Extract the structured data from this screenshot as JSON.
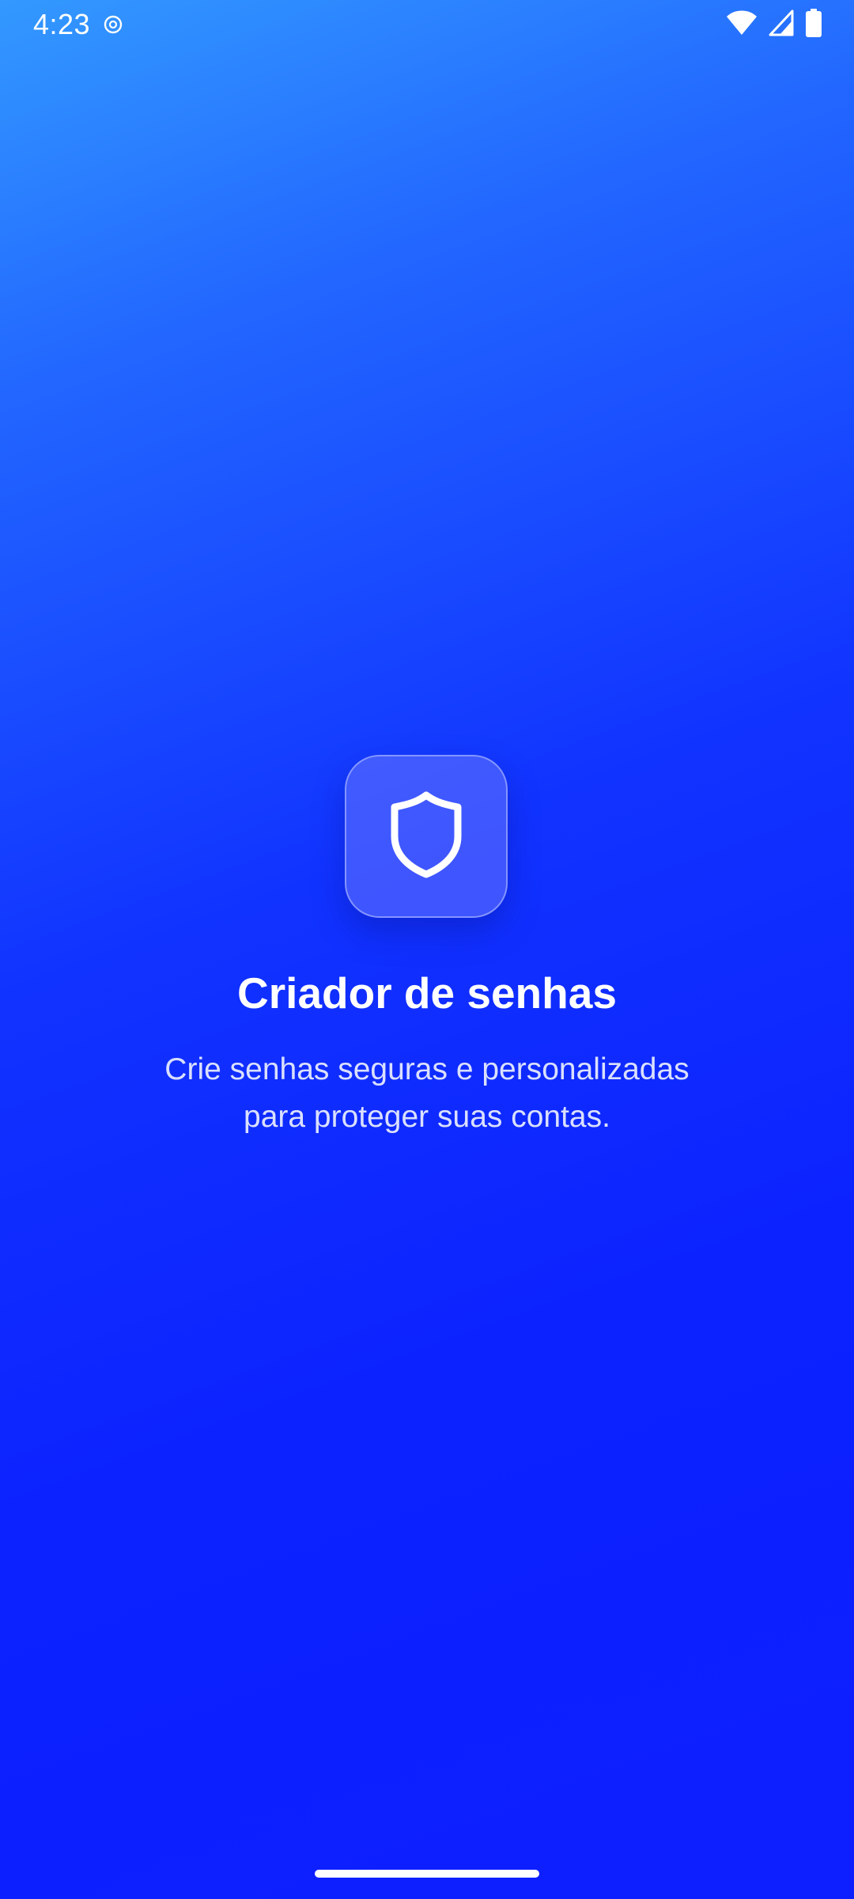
{
  "status_bar": {
    "time": "4:23",
    "icons": [
      "location-ring-icon",
      "wifi-icon",
      "cell-signal-icon",
      "battery-icon"
    ]
  },
  "splash": {
    "icon": "shield-icon",
    "title": "Criador de senhas",
    "subtitle_line_1": "Crie senhas seguras e personalizadas",
    "subtitle_line_2": "para proteger suas contas."
  },
  "colors": {
    "gradient_top": "#3399ff",
    "gradient_bottom": "#0d1eff",
    "text": "#ffffff"
  }
}
